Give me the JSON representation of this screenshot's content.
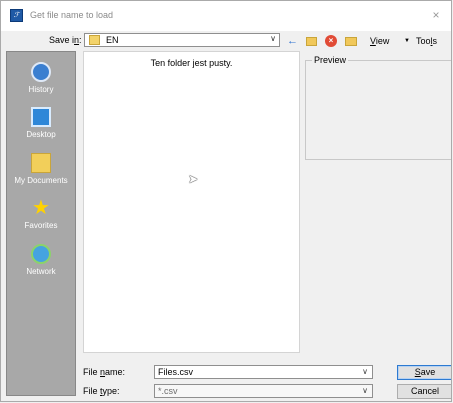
{
  "window": {
    "title": "Get file name to load",
    "close_glyph": "×"
  },
  "save_in": {
    "label_before": "Save i",
    "label_underlined": "n",
    "label_after": ":",
    "value": "EN"
  },
  "toolbar": {
    "back_icon": "back-arrow-icon",
    "view": {
      "underlined": "V",
      "rest": "iew"
    },
    "tools": {
      "before": "Too",
      "underlined": "l",
      "after": "s"
    }
  },
  "places": [
    {
      "label": "History",
      "icon": "history-icon"
    },
    {
      "label": "Desktop",
      "icon": "desktop-icon"
    },
    {
      "label": "My Documents",
      "icon": "my-documents-icon"
    },
    {
      "label": "Favorites",
      "icon": "favorites-icon"
    },
    {
      "label": "Network",
      "icon": "network-icon"
    }
  ],
  "file_list": {
    "empty_message": "Ten folder jest pusty."
  },
  "preview": {
    "label": "Preview"
  },
  "file_name": {
    "label_before": "File ",
    "label_underlined": "n",
    "label_after": "ame:",
    "value": "Files.csv"
  },
  "file_type": {
    "label_before": "File ",
    "label_underlined": "t",
    "label_after": "ype:",
    "value": "*.csv"
  },
  "buttons": {
    "save": {
      "underlined": "S",
      "rest": "ave"
    },
    "cancel": "Cancel"
  }
}
